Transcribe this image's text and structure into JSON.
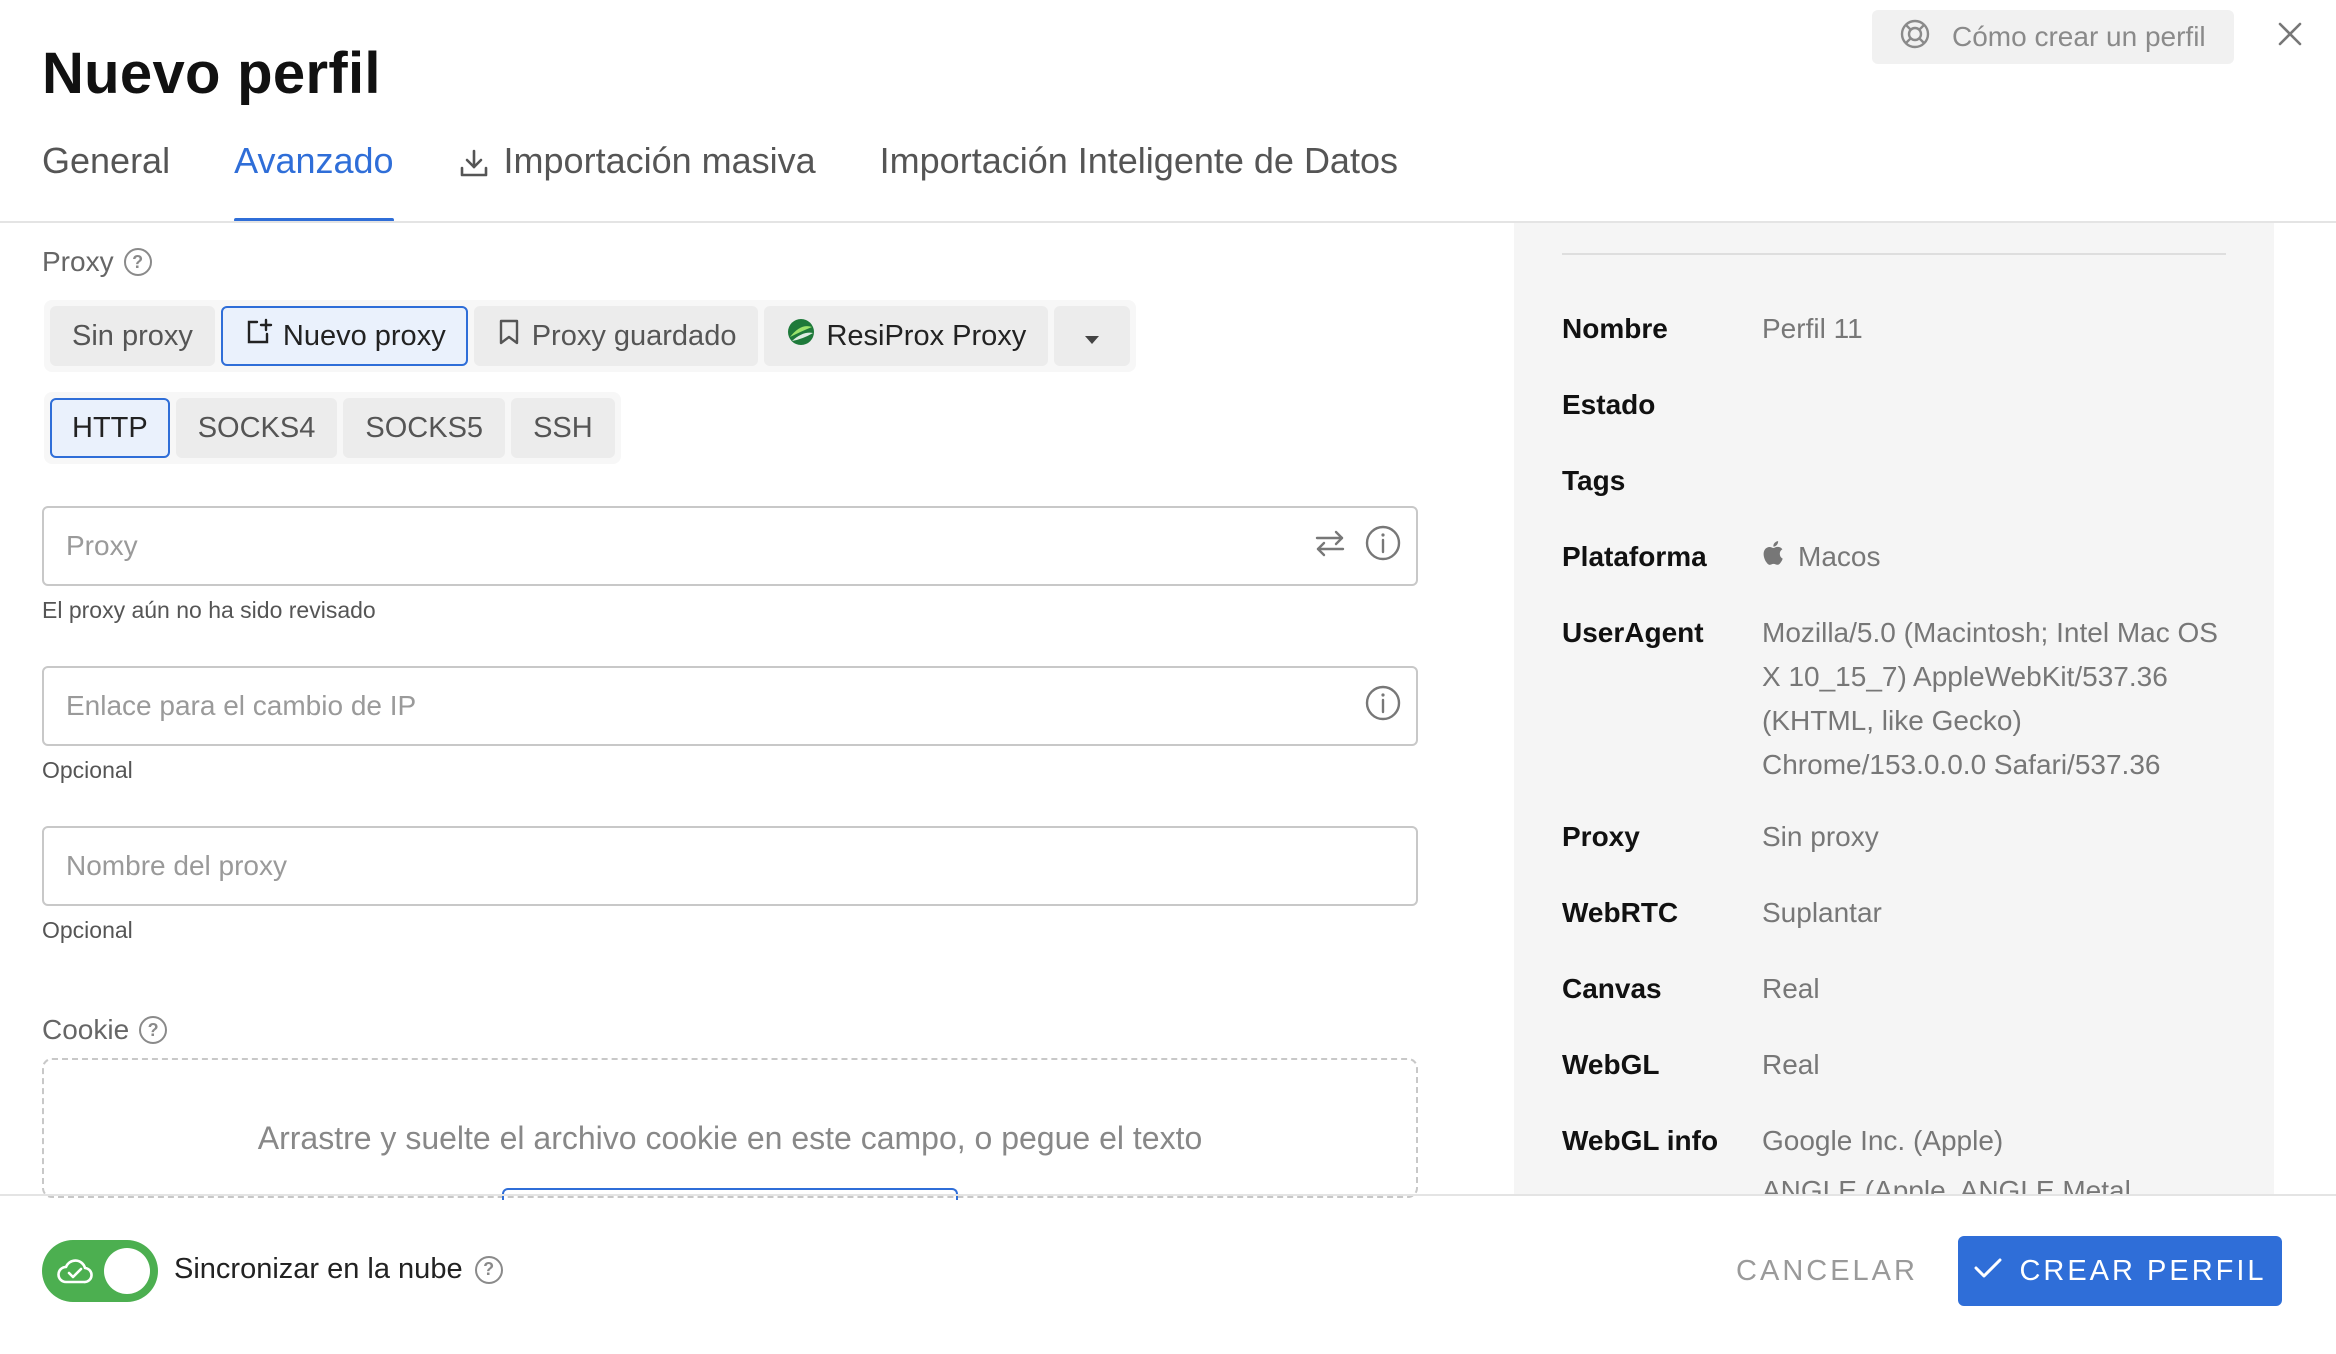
{
  "page": {
    "title": "Nuevo perfil",
    "help_link": "Cómo crear un perfil"
  },
  "tabs": [
    {
      "label": "General"
    },
    {
      "label": "Avanzado"
    },
    {
      "label": "Importación masiva",
      "icon": "download-icon"
    },
    {
      "label": "Importación Inteligente de Datos"
    }
  ],
  "proxy_section": {
    "label": "Proxy",
    "modes": [
      "Sin proxy",
      "Nuevo proxy",
      "Proxy guardado",
      "ResiProx Proxy"
    ],
    "selected_mode": "Nuevo proxy",
    "types": [
      "HTTP",
      "SOCKS4",
      "SOCKS5",
      "SSH"
    ],
    "selected_type": "HTTP",
    "proxy_placeholder": "Proxy",
    "proxy_helper": "El proxy aún no ha sido revisado",
    "ip_change_placeholder": "Enlace para el cambio de IP",
    "ip_change_helper": "Opcional",
    "name_placeholder": "Nombre del proxy",
    "name_helper": "Opcional"
  },
  "cookie_section": {
    "label": "Cookie",
    "dropzone_text": "Arrastre y suelte el archivo cookie en este campo, o pegue el texto"
  },
  "summary": {
    "rows": [
      {
        "key": "Nombre",
        "value": "Perfil 11"
      },
      {
        "key": "Estado",
        "value": ""
      },
      {
        "key": "Tags",
        "value": ""
      },
      {
        "key": "Plataforma",
        "value": "Macos",
        "icon": "apple-icon"
      },
      {
        "key": "UserAgent",
        "value": "Mozilla/5.0 (Macintosh; Intel Mac OS X 10_15_7) AppleWebKit/537.36 (KHTML, like Gecko) Chrome/153.0.0.0 Safari/537.36"
      },
      {
        "key": "Proxy",
        "value": "Sin proxy"
      },
      {
        "key": "WebRTC",
        "value": "Suplantar"
      },
      {
        "key": "Canvas",
        "value": "Real"
      },
      {
        "key": "WebGL",
        "value": "Real"
      },
      {
        "key": "WebGL info",
        "value": "Google Inc. (Apple)"
      },
      {
        "key": "",
        "value": "ANGLE (Apple, ANGLE Metal"
      }
    ]
  },
  "footer": {
    "sync_label": "Sincronizar en la nube",
    "sync_enabled": true,
    "cancel_label": "CANCELAR",
    "create_label": "CREAR PERFIL"
  },
  "colors": {
    "accent": "#2f6ed8",
    "toggle_on": "#4caf50",
    "panel_bg": "#f5f5f5"
  }
}
